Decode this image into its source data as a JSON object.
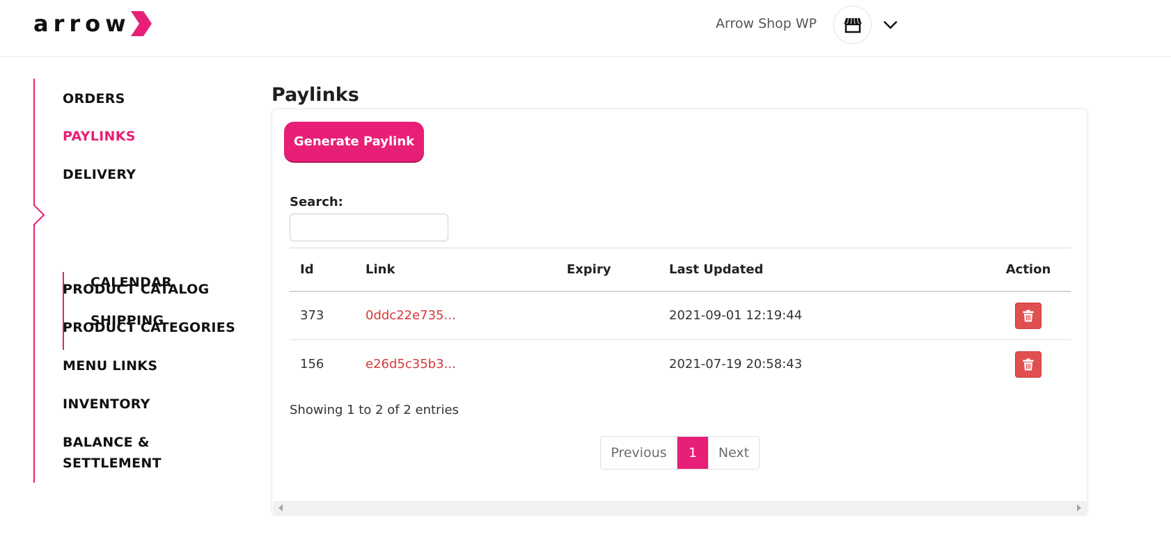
{
  "header": {
    "logo_text": "arrow",
    "shop_name": "Arrow Shop WP",
    "shop_icon": "store-icon",
    "menu_icon": "chevron-down-icon"
  },
  "colors": {
    "brand": "#e81f76",
    "link": "#d8383a",
    "danger": "#e05050"
  },
  "sidebar": {
    "items": [
      {
        "label": "ORDERS",
        "active": false
      },
      {
        "label": "PAYLINKS",
        "active": true
      },
      {
        "label": "DELIVERY",
        "active": false
      },
      {
        "label": "PRODUCT CATALOG",
        "active": false
      },
      {
        "label": "PRODUCT CATEGORIES",
        "active": false
      },
      {
        "label": "MENU LINKS",
        "active": false
      },
      {
        "label": "INVENTORY",
        "active": false
      },
      {
        "label": "BALANCE &",
        "active": false
      }
    ],
    "balance_line2": "SETTLEMENT",
    "delivery_sub": [
      {
        "label": "CALENDAR"
      },
      {
        "label": "SHIPPING"
      }
    ]
  },
  "main": {
    "title": "Paylinks",
    "generate_label": "Generate Paylink",
    "search_label": "Search:",
    "search_value": "",
    "table": {
      "headers": [
        "Id",
        "Link",
        "Expiry",
        "Last Updated",
        "Action"
      ],
      "rows": [
        {
          "id": "373",
          "link": "0ddc22e735...",
          "expiry": "",
          "updated": "2021-09-01 12:19:44",
          "action_icon": "trash-icon"
        },
        {
          "id": "156",
          "link": "e26d5c35b3...",
          "expiry": "",
          "updated": "2021-07-19 20:58:43",
          "action_icon": "trash-icon"
        }
      ]
    },
    "showing": "Showing 1 to 2 of 2 entries",
    "pagination": {
      "previous": "Previous",
      "current": "1",
      "next": "Next"
    }
  }
}
